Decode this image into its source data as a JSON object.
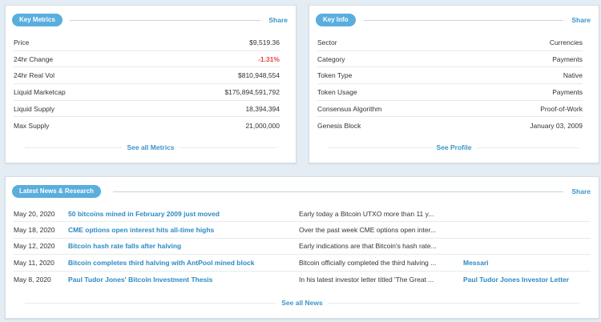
{
  "metrics": {
    "title": "Key Metrics",
    "share": "Share",
    "see_all": "See all Metrics",
    "rows": [
      {
        "label": "Price",
        "value": "$9,519.36"
      },
      {
        "label": "24hr Change",
        "value": "-1.31%"
      },
      {
        "label": "24hr Real Vol",
        "value": "$810,948,554"
      },
      {
        "label": "Liquid Marketcap",
        "value": "$175,894,591,792"
      },
      {
        "label": "Liquid Supply",
        "value": "18,394,394"
      },
      {
        "label": "Max Supply",
        "value": "21,000,000"
      }
    ]
  },
  "info": {
    "title": "Key Info",
    "share": "Share",
    "see_all": "See Profile",
    "rows": [
      {
        "label": "Sector",
        "value": "Currencies"
      },
      {
        "label": "Category",
        "value": "Payments"
      },
      {
        "label": "Token Type",
        "value": "Native"
      },
      {
        "label": "Token Usage",
        "value": "Payments"
      },
      {
        "label": "Consensus Algorithm",
        "value": "Proof-of-Work"
      },
      {
        "label": "Genesis Block",
        "value": "January 03, 2009"
      }
    ]
  },
  "news": {
    "title": "Latest News & Research",
    "share": "Share",
    "see_all": "See all News",
    "items": [
      {
        "date": "May 20, 2020",
        "title": "50 bitcoins mined in February 2009 just moved",
        "summary": "Early today a Bitcoin UTXO more than 11 y...",
        "source": ""
      },
      {
        "date": "May 18, 2020",
        "title": "CME options open interest hits all-time highs",
        "summary": "Over the past week CME options open inter...",
        "source": ""
      },
      {
        "date": "May 12, 2020",
        "title": "Bitcoin hash rate falls after halving",
        "summary": "Early indications are that Bitcoin's hash rate...",
        "source": ""
      },
      {
        "date": "May 11, 2020",
        "title": "Bitcoin completes third halving with AntPool mined block",
        "summary": "Bitcoin officially completed the third halving ...",
        "source": "Messari"
      },
      {
        "date": "May 8, 2020",
        "title": "Paul Tudor Jones' Bitcoin Investment Thesis",
        "summary": "In his latest investor letter titled 'The Great ...",
        "source": "Paul Tudor Jones Investor Letter"
      }
    ]
  },
  "colors": {
    "accent": "#5aaedd",
    "link": "#2b8ac4",
    "negative": "#e0474c",
    "background": "#e4edf4"
  }
}
